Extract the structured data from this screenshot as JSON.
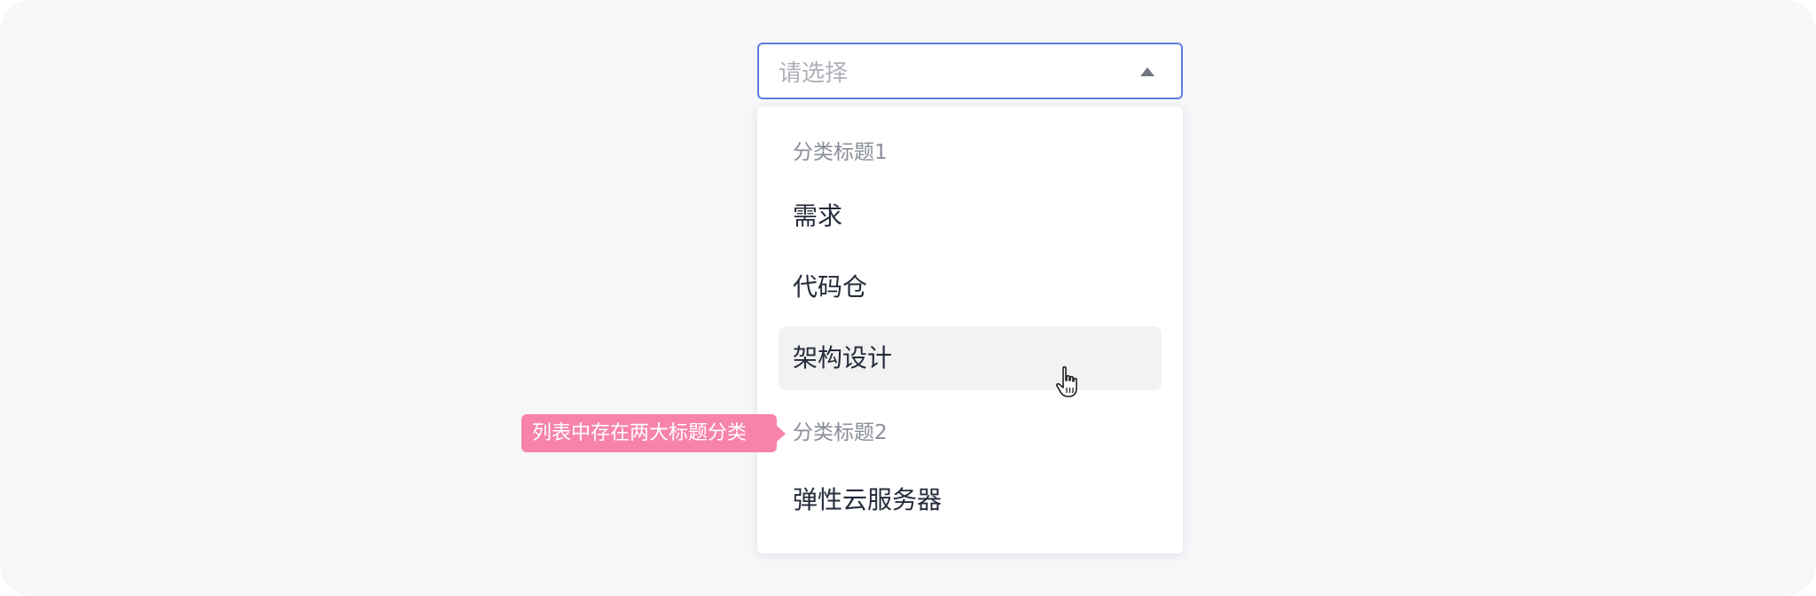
{
  "select": {
    "placeholder": "请选择",
    "accent_color": "#5e7ce0",
    "caret_icon": "caret-up-icon"
  },
  "dropdown": {
    "groups": [
      {
        "title": "分类标题1",
        "options": [
          {
            "label": "需求"
          },
          {
            "label": "代码仓"
          },
          {
            "label": "架构设计",
            "hovered": true
          }
        ]
      },
      {
        "title": "分类标题2",
        "options": [
          {
            "label": "弹性云服务器"
          }
        ]
      }
    ]
  },
  "annotation": {
    "text": "列表中存在两大标题分类",
    "color": "#f783ac"
  },
  "cursor": {
    "icon": "hand-pointer-icon"
  }
}
